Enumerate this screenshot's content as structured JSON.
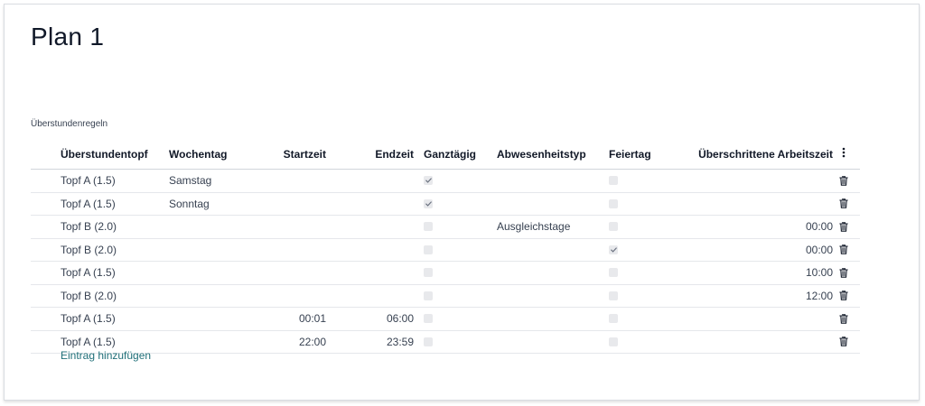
{
  "page": {
    "title": "Plan 1"
  },
  "section": {
    "label": "Überstundenregeln"
  },
  "table": {
    "columns": {
      "topf": "Überstundentopf",
      "wochentag": "Wochentag",
      "startzeit": "Startzeit",
      "endzeit": "Endzeit",
      "ganztaegig": "Ganztägig",
      "abwesenheitstyp": "Abwesenheitstyp",
      "feiertag": "Feiertag",
      "ueberschritten": "Überschrittene Arbeitszeit"
    },
    "rows": [
      {
        "topf": "Topf A (1.5)",
        "wochentag": "Samstag",
        "startzeit": "",
        "endzeit": "",
        "ganztaegig": true,
        "abwesenheitstyp": "",
        "feiertag": false,
        "ueberschritten": ""
      },
      {
        "topf": "Topf A (1.5)",
        "wochentag": "Sonntag",
        "startzeit": "",
        "endzeit": "",
        "ganztaegig": true,
        "abwesenheitstyp": "",
        "feiertag": false,
        "ueberschritten": ""
      },
      {
        "topf": "Topf B (2.0)",
        "wochentag": "",
        "startzeit": "",
        "endzeit": "",
        "ganztaegig": false,
        "abwesenheitstyp": "Ausgleichstage",
        "feiertag": false,
        "ueberschritten": "00:00"
      },
      {
        "topf": "Topf B (2.0)",
        "wochentag": "",
        "startzeit": "",
        "endzeit": "",
        "ganztaegig": false,
        "abwesenheitstyp": "",
        "feiertag": true,
        "ueberschritten": "00:00"
      },
      {
        "topf": "Topf A (1.5)",
        "wochentag": "",
        "startzeit": "",
        "endzeit": "",
        "ganztaegig": false,
        "abwesenheitstyp": "",
        "feiertag": false,
        "ueberschritten": "10:00"
      },
      {
        "topf": "Topf B (2.0)",
        "wochentag": "",
        "startzeit": "",
        "endzeit": "",
        "ganztaegig": false,
        "abwesenheitstyp": "",
        "feiertag": false,
        "ueberschritten": "12:00"
      },
      {
        "topf": "Topf A (1.5)",
        "wochentag": "",
        "startzeit": "00:01",
        "endzeit": "06:00",
        "ganztaegig": false,
        "abwesenheitstyp": "",
        "feiertag": false,
        "ueberschritten": ""
      },
      {
        "topf": "Topf A (1.5)",
        "wochentag": "",
        "startzeit": "22:00",
        "endzeit": "23:59",
        "ganztaegig": false,
        "abwesenheitstyp": "",
        "feiertag": false,
        "ueberschritten": ""
      }
    ],
    "add_label": "Eintrag hinzufügen",
    "icons": {
      "column_menu": "kebab-menu-icon",
      "row_delete": "trash-icon",
      "checked": "checkmark-icon"
    }
  },
  "colors": {
    "accent_link": "#1f6f78",
    "checkbox_bg": "#e8e9ec",
    "row_border": "#e5e7eb"
  }
}
